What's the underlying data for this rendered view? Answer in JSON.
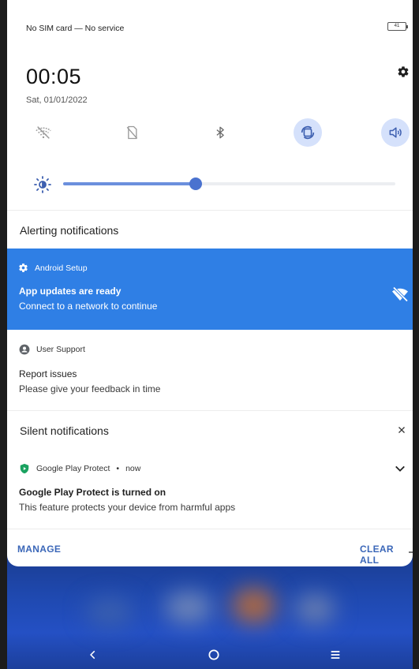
{
  "status_bar": {
    "carrier_text": "No SIM card — No service",
    "battery_level": "41"
  },
  "header": {
    "time": "00:05",
    "date": "Sat, 01/01/2022",
    "settings_icon": "gear-icon"
  },
  "quick_settings": {
    "tiles": [
      {
        "name": "wifi",
        "icon": "wifi-off-icon",
        "active": false
      },
      {
        "name": "mobile-data",
        "icon": "sim-off-icon",
        "active": false
      },
      {
        "name": "bluetooth",
        "icon": "bluetooth-icon",
        "active": false
      },
      {
        "name": "auto-rotate",
        "icon": "rotate-icon",
        "active": true
      },
      {
        "name": "sound",
        "icon": "volume-icon",
        "active": true
      }
    ],
    "brightness_level": 0.4,
    "accent_color": "#4a72cf",
    "active_tile_color": "#d5e1fb"
  },
  "alerting": {
    "title": "Alerting notifications",
    "notifications": [
      {
        "app": "Android Setup",
        "title": "App updates are ready",
        "body": "Connect to a network to continue",
        "background": "#2f7fe5"
      },
      {
        "app": "User Support",
        "title": "Report issues",
        "body": "Please give your feedback in time"
      }
    ]
  },
  "silent": {
    "title": "Silent notifications",
    "notifications": [
      {
        "app": "Google Play Protect",
        "time": "now",
        "separator": "•",
        "title": "Google Play Protect is turned on",
        "body": "This feature protects your device from harmful apps",
        "shield_color": "#1aa260"
      }
    ]
  },
  "footer": {
    "manage_label": "MANAGE",
    "clear_all_label": "CLEAR ALL"
  },
  "nav_bar": {
    "back_icon": "chevron-left-icon",
    "home_icon": "circle-icon",
    "recents_icon": "menu-icon"
  }
}
